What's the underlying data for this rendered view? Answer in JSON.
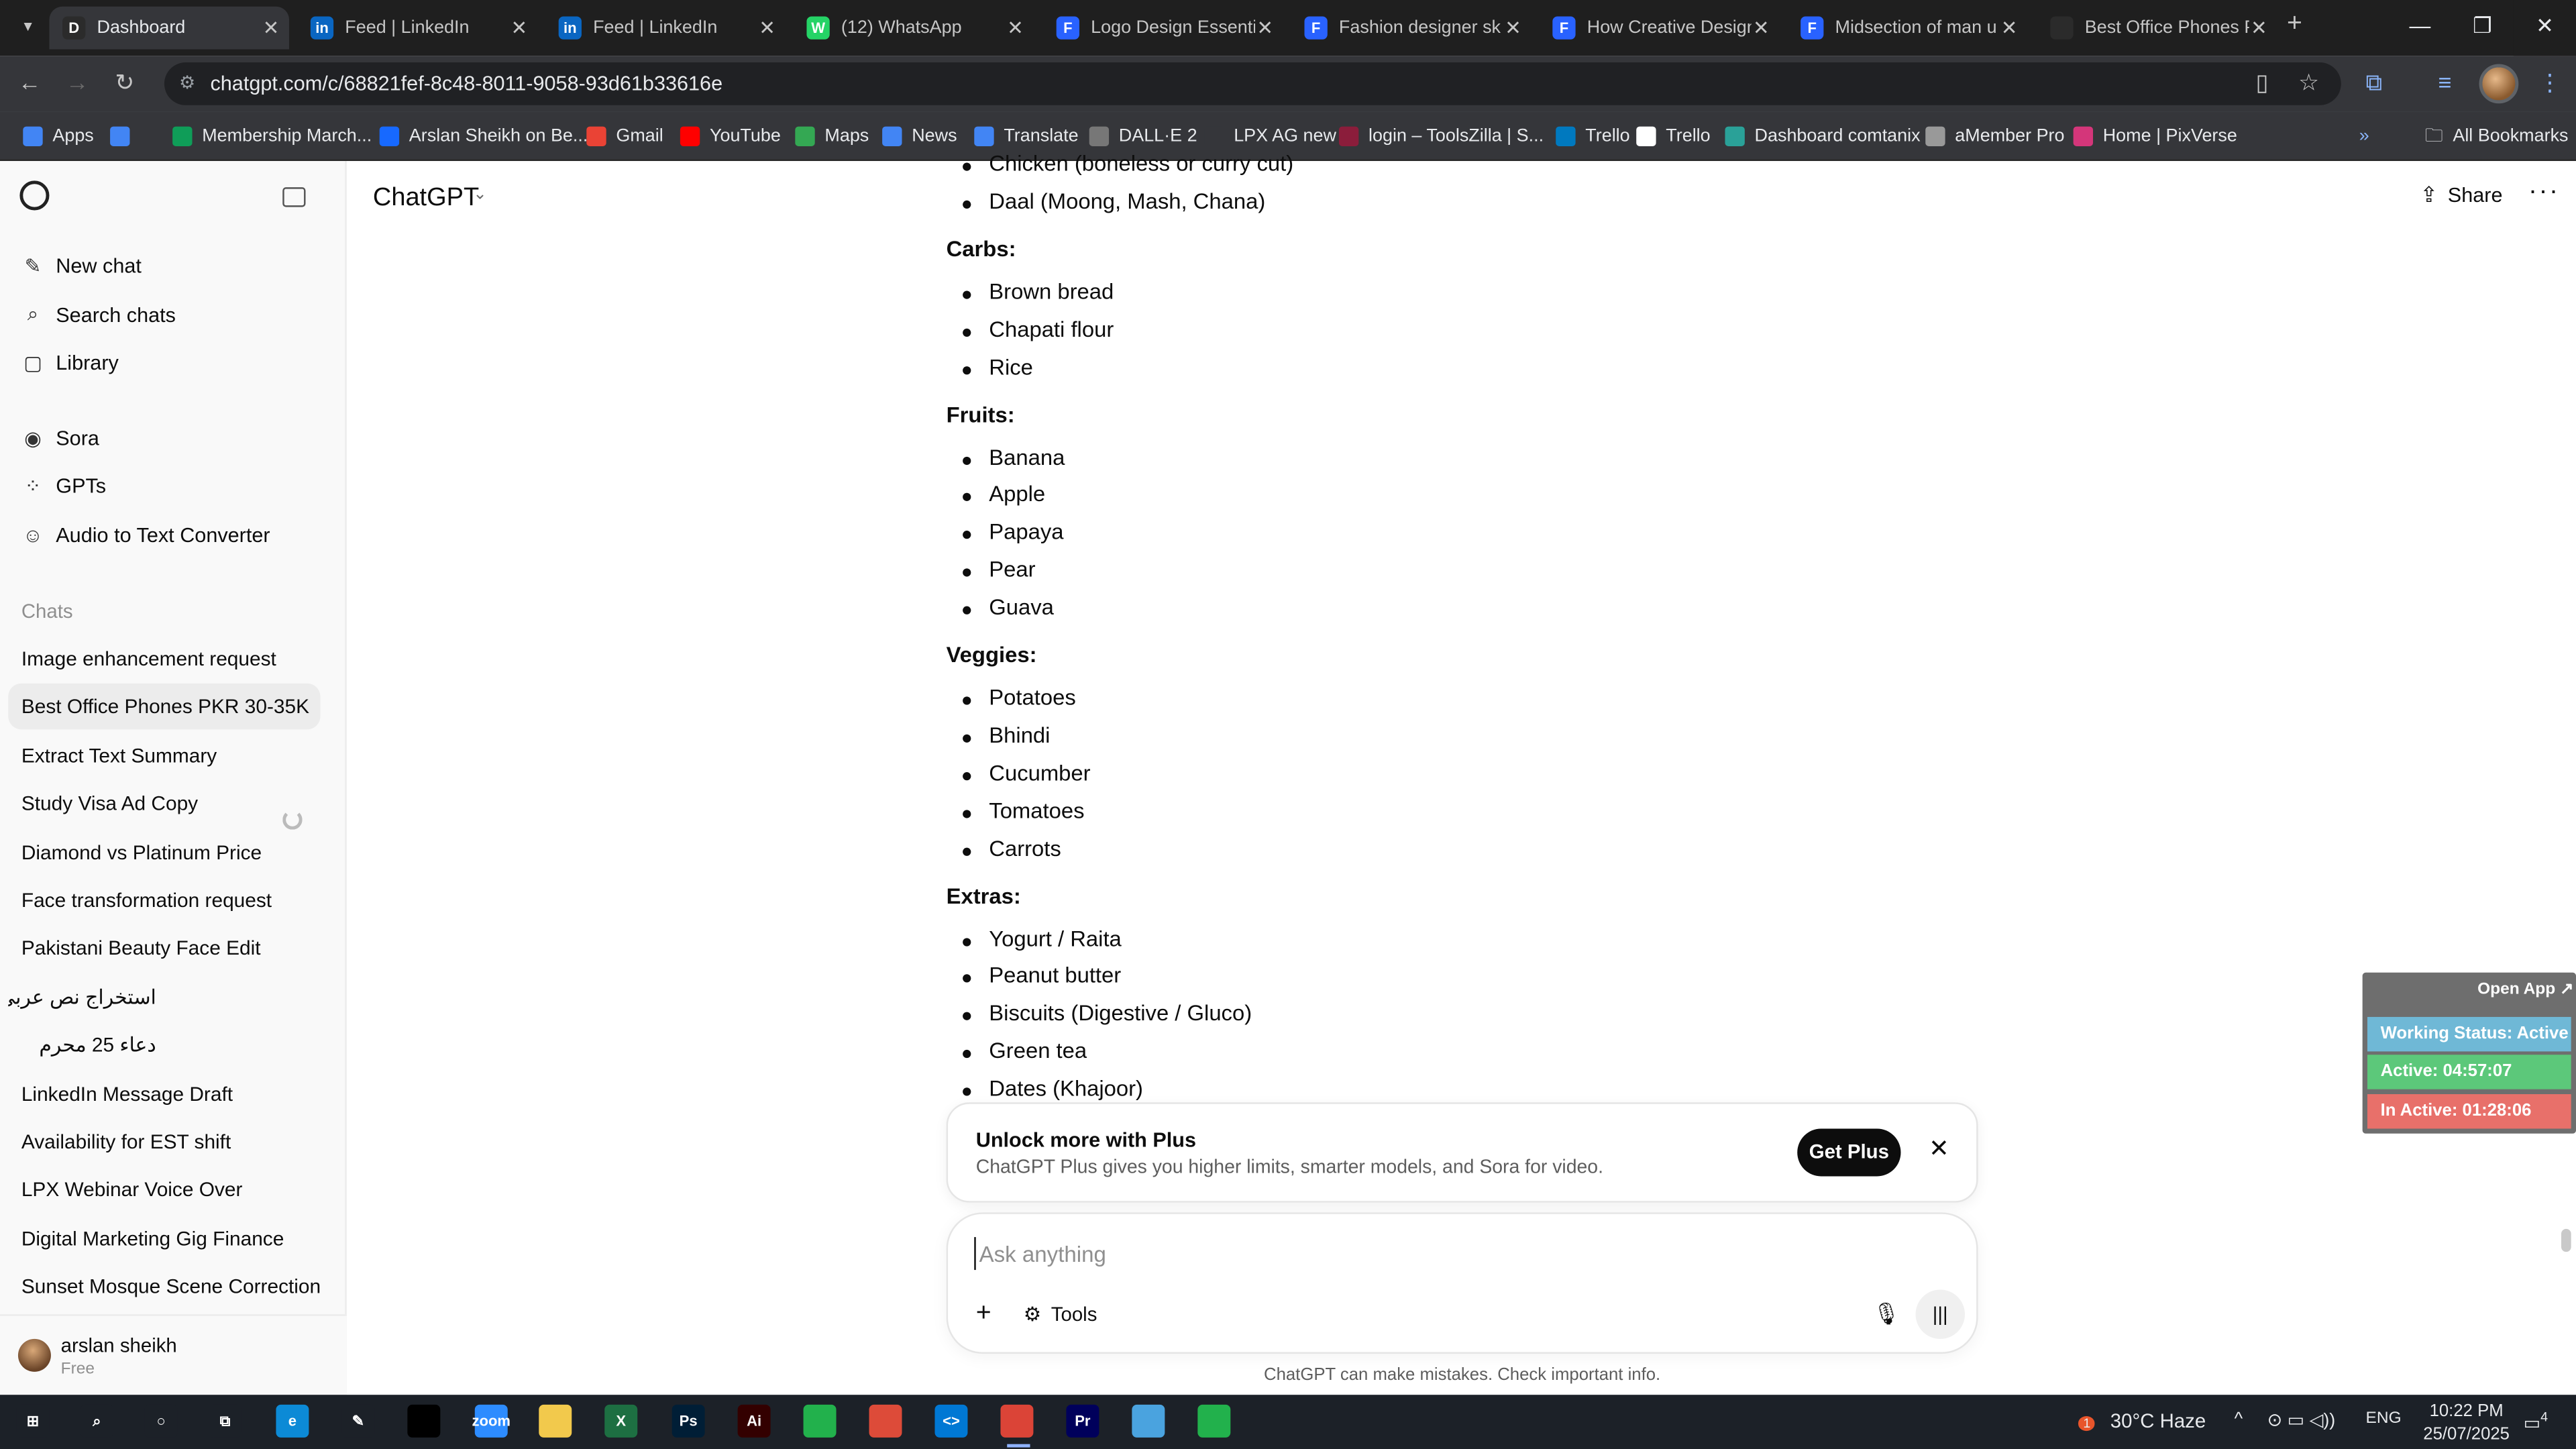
{
  "browser": {
    "tabs": [
      {
        "title": "Dashboard",
        "icon_color": "#2b2b2b",
        "icon": "D"
      },
      {
        "title": "Feed | LinkedIn",
        "icon_color": "#0a66c2",
        "icon": "in"
      },
      {
        "title": "Feed | LinkedIn",
        "icon_color": "#0a66c2",
        "icon": "in"
      },
      {
        "title": "(12) WhatsApp",
        "icon_color": "#25d366",
        "icon": "W"
      },
      {
        "title": "Logo Design Essenti",
        "icon_color": "#2962ff",
        "icon": "F"
      },
      {
        "title": "Fashion designer sk",
        "icon_color": "#2962ff",
        "icon": "F"
      },
      {
        "title": "How Creative Design",
        "icon_color": "#2962ff",
        "icon": "F"
      },
      {
        "title": "Midsection of man u",
        "icon_color": "#2962ff",
        "icon": "F"
      },
      {
        "title": "Best Office Phones P",
        "icon_color": "#2b2b2b",
        "icon": ""
      }
    ],
    "url": "chatgpt.com/c/68821fef-8c48-8011-9058-93d61b33616e",
    "bookmarks": [
      {
        "label": "Apps",
        "color": "#4285f4"
      },
      {
        "label": "",
        "color": "#4285f4"
      },
      {
        "label": "Membership March...",
        "color": "#0f9d58"
      },
      {
        "label": "Arslan Sheikh on Be...",
        "color": "#1769ff"
      },
      {
        "label": "Gmail",
        "color": "#ea4335"
      },
      {
        "label": "YouTube",
        "color": "#ff0000"
      },
      {
        "label": "Maps",
        "color": "#34a853"
      },
      {
        "label": "News",
        "color": "#4285f4"
      },
      {
        "label": "Translate",
        "color": "#4285f4"
      },
      {
        "label": "DALL·E 2",
        "color": "#777777"
      },
      {
        "label": "LPX AG new",
        "color": "#35363a"
      },
      {
        "label": "login – ToolsZilla | S...",
        "color": "#8b1d3b"
      },
      {
        "label": "Trello",
        "color": "#0079bf"
      },
      {
        "label": "Trello",
        "color": "#ffffff"
      },
      {
        "label": "Dashboard comtanix",
        "color": "#2aa198"
      },
      {
        "label": "aMember Pro",
        "color": "#999999"
      },
      {
        "label": "Home | PixVerse",
        "color": "#d4367a"
      }
    ],
    "all_bookmarks": "All Bookmarks"
  },
  "sidebar": {
    "nav": [
      {
        "label": "New chat",
        "icon": "✎"
      },
      {
        "label": "Search chats",
        "icon": "⌕"
      },
      {
        "label": "Library",
        "icon": "▢"
      }
    ],
    "apps": [
      {
        "label": "Sora",
        "icon": "◉"
      },
      {
        "label": "GPTs",
        "icon": "⁘"
      },
      {
        "label": "Audio to Text Converter",
        "icon": "☺"
      }
    ],
    "chats_heading": "Chats",
    "chats": [
      "Image enhancement request",
      "Best Office Phones PKR 30-35K",
      "Extract Text Summary",
      "Study Visa Ad Copy",
      "Diamond vs Platinum Price",
      "Face transformation request",
      "Pakistani Beauty Face Edit",
      "استخراج نص عربي",
      "دعاء 25 محرم",
      "LinkedIn Message Draft",
      "Availability for EST shift",
      "LPX Webinar Voice Over",
      "Digital Marketing Gig Finance",
      "Sunset Mosque Scene Correction"
    ],
    "user": {
      "name": "arslan sheikh",
      "plan": "Free"
    }
  },
  "header": {
    "model": "ChatGPT",
    "share": "Share"
  },
  "conversation": {
    "partial_items": [
      "Chicken (boneless or curry cut)",
      "Daal (Moong, Mash, Chana)"
    ],
    "sections": [
      {
        "title": "Carbs:",
        "items": [
          "Brown bread",
          "Chapati flour",
          "Rice"
        ]
      },
      {
        "title": "Fruits:",
        "items": [
          "Banana",
          "Apple",
          "Papaya",
          "Pear",
          "Guava"
        ]
      },
      {
        "title": "Veggies:",
        "items": [
          "Potatoes",
          "Bhindi",
          "Cucumber",
          "Tomatoes",
          "Carrots"
        ]
      },
      {
        "title": "Extras:",
        "items": [
          "Yogurt / Raita",
          "Peanut butter",
          "Biscuits (Digestive / Gluco)",
          "Green tea",
          "Dates (Khajoor)"
        ]
      }
    ]
  },
  "upsell": {
    "title": "Unlock more with Plus",
    "description": "ChatGPT Plus gives you higher limits, smarter models, and Sora for video.",
    "button": "Get Plus"
  },
  "composer": {
    "placeholder": "Ask anything",
    "tools": "Tools"
  },
  "disclaimer": "ChatGPT can make mistakes. Check important info.",
  "status_widget": {
    "open_app": "Open App ↗",
    "working_status": "Working Status: Active",
    "active": "Active: 04:57:07",
    "inactive": "In Active: 01:28:06",
    "colors": {
      "working": "#6fb8d6",
      "active": "#5cc87a",
      "inactive": "#e8706a"
    }
  },
  "taskbar": {
    "apps": [
      {
        "name": "start",
        "color": "#1c2128",
        "label": "⊞"
      },
      {
        "name": "search",
        "color": "#1c2128",
        "label": "⌕"
      },
      {
        "name": "cortana",
        "color": "#1c2128",
        "label": "○"
      },
      {
        "name": "task-view",
        "color": "#1c2128",
        "label": "⧉"
      },
      {
        "name": "edge",
        "color": "#0c8ad6",
        "label": "e"
      },
      {
        "name": "pen",
        "color": "#1c2128",
        "label": "✎"
      },
      {
        "name": "terminal",
        "color": "#000000",
        "label": ""
      },
      {
        "name": "zoom",
        "color": "#2d8cff",
        "label": "zoom"
      },
      {
        "name": "explorer",
        "color": "#f2c94c",
        "label": ""
      },
      {
        "name": "excel",
        "color": "#1d6f42",
        "label": "X"
      },
      {
        "name": "photoshop",
        "color": "#001e36",
        "label": "Ps"
      },
      {
        "name": "illustrator",
        "color": "#330000",
        "label": "Ai"
      },
      {
        "name": "app-green",
        "color": "#22b14c",
        "label": ""
      },
      {
        "name": "chrome",
        "color": "#dd4b39",
        "label": ""
      },
      {
        "name": "vscode",
        "color": "#0078d4",
        "label": "<>"
      },
      {
        "name": "chrome-active",
        "color": "#db4437",
        "label": ""
      },
      {
        "name": "premiere",
        "color": "#00005b",
        "label": "Pr"
      },
      {
        "name": "app-blue",
        "color": "#4aa3df",
        "label": ""
      },
      {
        "name": "app-green-2",
        "color": "#22b14c",
        "label": ""
      }
    ],
    "weather": "30°C  Haze",
    "weather_badge": "1",
    "lang": "ENG",
    "time": "10:22 PM",
    "date": "25/07/2025",
    "notif_count": "4"
  }
}
